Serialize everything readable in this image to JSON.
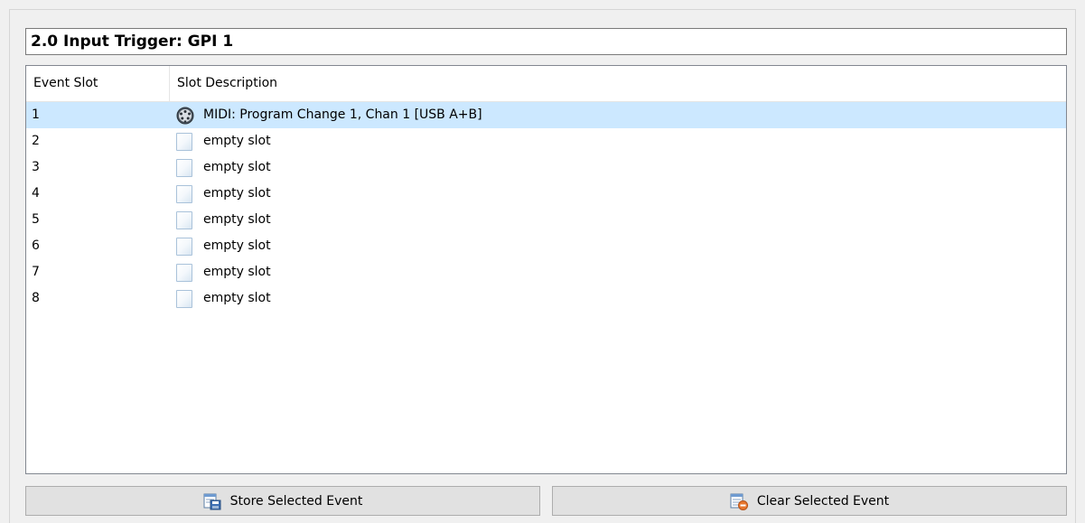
{
  "title": "2.0 Input Trigger: GPI 1",
  "table": {
    "columns": [
      "Event Slot",
      "Slot Description"
    ],
    "rows": [
      {
        "slot": "1",
        "description": "MIDI: Program Change 1, Chan 1 [USB A+B]",
        "icon": "midi-connector-icon",
        "selected": true
      },
      {
        "slot": "2",
        "description": "empty slot",
        "icon": "document-icon",
        "selected": false
      },
      {
        "slot": "3",
        "description": "empty slot",
        "icon": "document-icon",
        "selected": false
      },
      {
        "slot": "4",
        "description": "empty slot",
        "icon": "document-icon",
        "selected": false
      },
      {
        "slot": "5",
        "description": "empty slot",
        "icon": "document-icon",
        "selected": false
      },
      {
        "slot": "6",
        "description": "empty slot",
        "icon": "document-icon",
        "selected": false
      },
      {
        "slot": "7",
        "description": "empty slot",
        "icon": "document-icon",
        "selected": false
      },
      {
        "slot": "8",
        "description": "empty slot",
        "icon": "document-icon",
        "selected": false
      }
    ]
  },
  "buttons": {
    "store_label": "Store Selected Event",
    "store_icon": "store-event-icon",
    "clear_label": "Clear Selected Event",
    "clear_icon": "clear-event-icon"
  },
  "colors": {
    "selection": "#cce8ff",
    "background": "#f0f0f0",
    "button_face": "#e1e1e1"
  }
}
